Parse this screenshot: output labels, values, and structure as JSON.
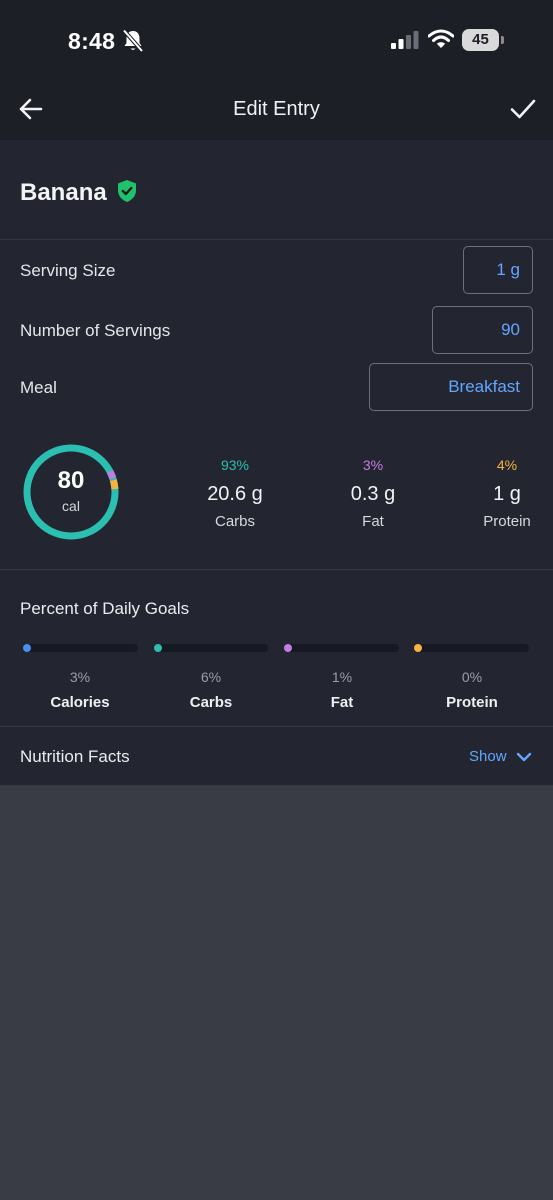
{
  "status_bar": {
    "time": "8:48",
    "battery": "45"
  },
  "header": {
    "title": "Edit Entry"
  },
  "food": {
    "name": "Banana"
  },
  "fields": {
    "serving_size": {
      "label": "Serving Size",
      "value": "1 g"
    },
    "servings": {
      "label": "Number of Servings",
      "value": "90"
    },
    "meal": {
      "label": "Meal",
      "value": "Breakfast"
    }
  },
  "summary": {
    "calories": "80",
    "calories_unit": "cal",
    "macros": [
      {
        "percent": "93%",
        "amount": "20.6 g",
        "name": "Carbs",
        "color": "#2bbfb1"
      },
      {
        "percent": "3%",
        "amount": "0.3 g",
        "name": "Fat",
        "color": "#c37ce6"
      },
      {
        "percent": "4%",
        "amount": "1 g",
        "name": "Protein",
        "color": "#f5b340"
      }
    ]
  },
  "daily_goals": {
    "title": "Percent of Daily Goals",
    "items": [
      {
        "percent": "3%",
        "name": "Calories",
        "fraction": 0.03,
        "color": "#4a90e8"
      },
      {
        "percent": "6%",
        "name": "Carbs",
        "fraction": 0.06,
        "color": "#2bbfb1"
      },
      {
        "percent": "1%",
        "name": "Fat",
        "fraction": 0.01,
        "color": "#c37ce6"
      },
      {
        "percent": "0%",
        "name": "Protein",
        "fraction": 0.0,
        "color": "#f5b340"
      }
    ]
  },
  "nutrition_facts": {
    "title": "Nutrition Facts",
    "toggle": "Show"
  },
  "icons": {
    "back": "arrow-left-icon",
    "confirm": "checkmark-icon",
    "verified": "verified-shield-icon",
    "expand": "chevron-down-icon",
    "muted": "bell-slash-icon",
    "signal": "cellular-signal-icon",
    "wifi": "wifi-icon"
  },
  "colors": {
    "accent": "#63a6ff",
    "verified": "#1fc26a"
  }
}
